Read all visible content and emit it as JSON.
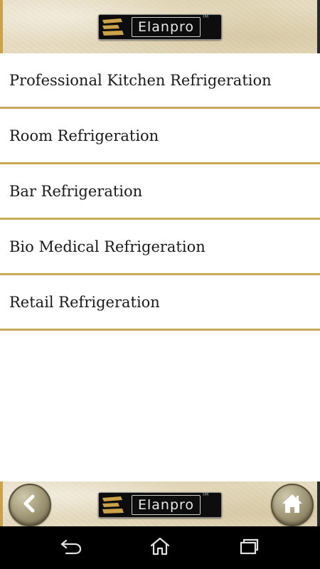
{
  "header": {
    "logo_text": "Elanpro",
    "logo_tm": "TM"
  },
  "categories": [
    {
      "label": "Professional Kitchen Refrigeration"
    },
    {
      "label": "Room Refrigeration"
    },
    {
      "label": "Bar Refrigeration"
    },
    {
      "label": "Bio Medical Refrigeration"
    },
    {
      "label": "Retail Refrigeration"
    }
  ],
  "footer": {
    "logo_text": "Elanpro",
    "logo_tm": "TM",
    "back_icon": "chevron-left-icon",
    "home_icon": "home-icon"
  },
  "system_nav": {
    "back_icon": "back-arrow-icon",
    "home_icon": "home-outline-icon",
    "recent_icon": "recent-apps-icon"
  },
  "colors": {
    "divider": "#c8a95a",
    "parchment": "#e6dcc1",
    "logo_bg": "#0d0d0d",
    "logo_mark": "#c9a24a"
  }
}
